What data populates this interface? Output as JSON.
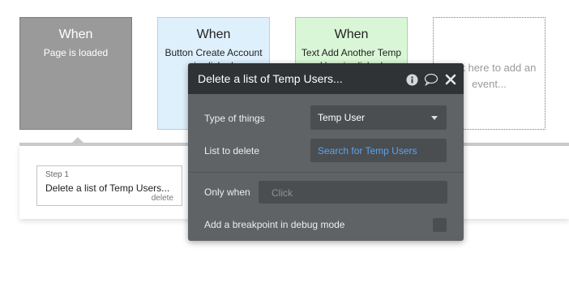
{
  "events": [
    {
      "when": "When",
      "description": "Page is loaded"
    },
    {
      "when": "When",
      "description": "Button Create Account is clicked"
    },
    {
      "when": "When",
      "description": "Text Add Another Temp User is clicked"
    }
  ],
  "add_event": {
    "label": "Click here to add an event..."
  },
  "workflow": {
    "step": {
      "number": "Step 1",
      "title": "Delete a list of Temp Users...",
      "delete_label": "delete"
    }
  },
  "dialog": {
    "title": "Delete a list of Temp Users...",
    "icons": [
      "info-icon",
      "comment-icon",
      "close-icon"
    ],
    "type_of_things_label": "Type of things",
    "type_of_things_value": "Temp User",
    "list_to_delete_label": "List to delete",
    "list_to_delete_placeholder": "Search for Temp Users",
    "only_when_label": "Only when",
    "only_when_placeholder": "Click",
    "breakpoint_label": "Add a breakpoint in debug mode"
  },
  "colors": {
    "dialog_bg": "#5f6366",
    "dialog_header_bg": "#2f3336",
    "field_bg": "#4a4e51",
    "link_blue": "#5aa4ef",
    "card_gray": "#9a9a9a",
    "card_blue": "#dff0fd",
    "card_green": "#d9f7d6"
  }
}
